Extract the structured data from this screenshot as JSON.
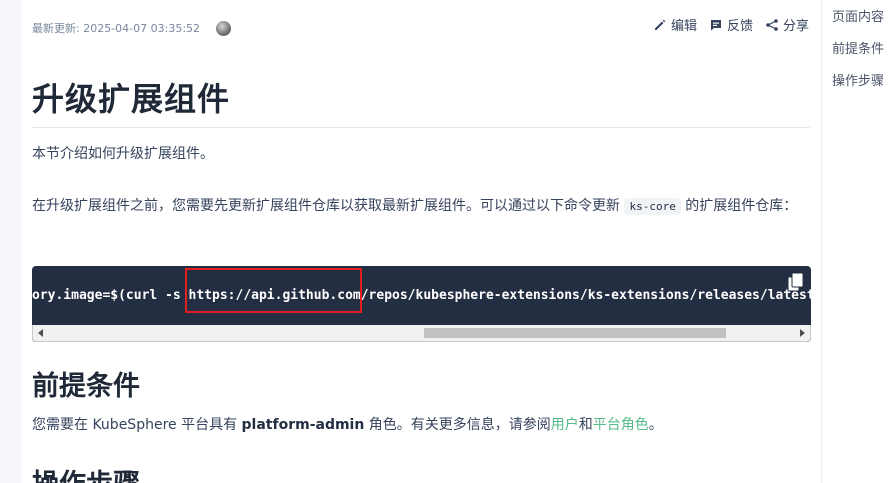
{
  "meta": {
    "last_updated": "最新更新: 2025-04-07 03:35:52"
  },
  "actions": {
    "edit": "编辑",
    "feedback": "反馈",
    "share": "分享"
  },
  "title": "升级扩展组件",
  "intro": "本节介绍如何升级扩展组件。",
  "para2": {
    "before": "在升级扩展组件之前，您需要先更新扩展组件仓库以获取最新扩展组件。可以通过以下命令更新 ",
    "code": "ks-core",
    "after": " 的扩展组件仓库："
  },
  "code_block": {
    "visible_text": "ory.image=$(curl -s https://api.github.com/repos/kubesphere-extensions/ks-extensions/releases/latest"
  },
  "sections": {
    "prereq_title": "前提条件",
    "steps_title": "操作步骤"
  },
  "prereq": {
    "p1": "您需要在 KubeSphere 平台具有 ",
    "bold": "platform-admin",
    "p2": " 角色。有关更多信息，请参阅",
    "link_users": "用户",
    "and": "和",
    "link_roles": "平台角色",
    "end": "。"
  },
  "toc": {
    "items": [
      "页面内容",
      "前提条件",
      "操作步骤"
    ]
  },
  "colors": {
    "code_bg": "#242e42",
    "link": "#55bc8a",
    "highlight": "#e0201f"
  }
}
